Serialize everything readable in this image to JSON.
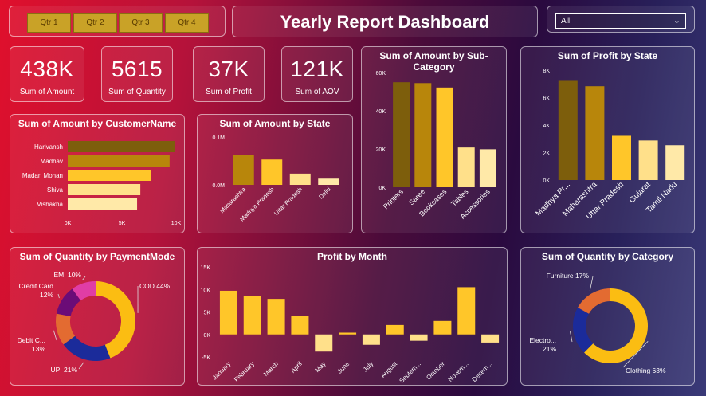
{
  "slicers": {
    "quarters": [
      "Qtr 1",
      "Qtr 2",
      "Qtr 3",
      "Qtr 4"
    ],
    "dropdown_value": "All"
  },
  "header": {
    "title": "Yearly Report Dashboard"
  },
  "kpis": [
    {
      "value": "438K",
      "label": "Sum of Amount"
    },
    {
      "value": "5615",
      "label": "Sum of Quantity"
    },
    {
      "value": "37K",
      "label": "Sum of Profit"
    },
    {
      "value": "121K",
      "label": "Sum of AOV"
    }
  ],
  "colors": {
    "dark_gold": "#7d5e0c",
    "gold": "#b8860b",
    "yellow": "#ffc629",
    "light_yellow": "#ffe08a",
    "pale_yellow": "#ffe9a8"
  },
  "chart_data": [
    {
      "id": "customer",
      "type": "bar",
      "orientation": "horizontal",
      "title": "Sum of Amount by CustomerName",
      "categories": [
        "Harivansh",
        "Madhav",
        "Madan Mohan",
        "Shiva",
        "Vishakha"
      ],
      "values": [
        9900,
        9400,
        7700,
        6700,
        6400
      ],
      "xticks": [
        "0K",
        "5K",
        "10K"
      ],
      "xlim": [
        0,
        10000
      ]
    },
    {
      "id": "state_amount",
      "type": "bar",
      "title": "Sum of Amount by State",
      "categories": [
        "Maharashtra",
        "Madhya Pradesh",
        "Uttar Pradesh",
        "Delhi"
      ],
      "values": [
        0.105,
        0.09,
        0.04,
        0.022
      ],
      "yticks": [
        "0.0M",
        "0.1M"
      ],
      "ylim": [
        0,
        0.17
      ]
    },
    {
      "id": "subcategory",
      "type": "bar",
      "title": "Sum of Amount by Sub-Category",
      "categories": [
        "Printers",
        "Saree",
        "Bookcases",
        "Tables",
        "Accessories"
      ],
      "values": [
        59500,
        59000,
        56500,
        22500,
        21500
      ],
      "yticks": [
        "0K",
        "20K",
        "40K",
        "60K"
      ],
      "ylim": [
        0,
        65000
      ]
    },
    {
      "id": "state_profit",
      "type": "bar",
      "title": "Sum of Profit by State",
      "categories": [
        "Madhya Pr...",
        "Maharashtra",
        "Uttar Pradesh",
        "Gujarat",
        "Tamil Nadu"
      ],
      "values": [
        7400,
        7000,
        3300,
        2950,
        2600
      ],
      "yticks": [
        "0K",
        "2K",
        "4K",
        "6K",
        "8K"
      ],
      "ylim": [
        0,
        8200
      ]
    },
    {
      "id": "payment",
      "type": "pie",
      "donut": true,
      "title": "Sum of Quantity by PaymentMode",
      "slices": [
        {
          "name": "COD",
          "label": "COD 44%",
          "value": 44,
          "color": "#fbbd12"
        },
        {
          "name": "UPI",
          "label": "UPI 21%",
          "value": 21,
          "color": "#1b2b9a"
        },
        {
          "name": "Debit C...",
          "label": "Debit C... 13%",
          "label_lines": [
            "Debit C...",
            "13%"
          ],
          "value": 13,
          "color": "#e36b31"
        },
        {
          "name": "Credit Card",
          "label": "Credit Card 12%",
          "label_lines": [
            "Credit Card",
            "12%"
          ],
          "value": 12,
          "color": "#6b0c77"
        },
        {
          "name": "EMI",
          "label": "EMI 10%",
          "value": 10,
          "color": "#e03da6"
        }
      ]
    },
    {
      "id": "month",
      "type": "bar",
      "title": "Profit by Month",
      "categories": [
        "January",
        "February",
        "March",
        "April",
        "May",
        "June",
        "July",
        "August",
        "Septem...",
        "October",
        "Novem...",
        "Decem..."
      ],
      "values": [
        9700,
        8500,
        7900,
        4200,
        -3800,
        400,
        -2300,
        2100,
        -1400,
        3000,
        10500,
        -1800
      ],
      "yticks": [
        "-5K",
        "0K",
        "5K",
        "10K",
        "15K"
      ],
      "ylim": [
        -5000,
        15000
      ]
    },
    {
      "id": "category",
      "type": "pie",
      "donut": true,
      "title": "Sum of Quantity by Category",
      "slices": [
        {
          "name": "Clothing",
          "label": "Clothing 63%",
          "value": 63,
          "color": "#fbbd12"
        },
        {
          "name": "Electro...",
          "label": "Electro... 21%",
          "label_lines": [
            "Electro...",
            "21%"
          ],
          "value": 21,
          "color": "#1b2b9a"
        },
        {
          "name": "Furniture",
          "label": "Furniture 17%",
          "value": 17,
          "color": "#e36b31"
        }
      ]
    }
  ]
}
